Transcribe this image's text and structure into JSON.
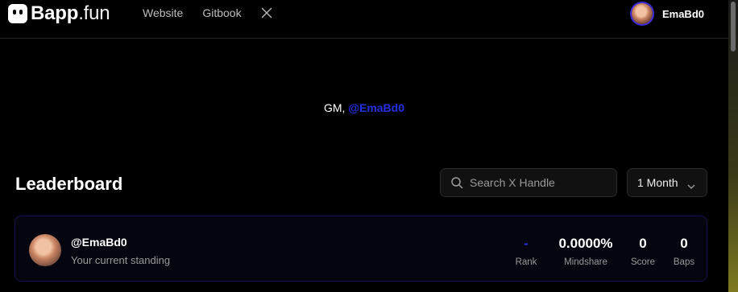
{
  "brand": {
    "name_bold": "Bapp",
    "name_light": ".fun"
  },
  "nav": {
    "website": "Website",
    "gitbook": "Gitbook"
  },
  "user": {
    "name": "EmaBd0"
  },
  "greeting": {
    "prefix": "GM, ",
    "handle": "@EmaBd0"
  },
  "leaderboard": {
    "title": "Leaderboard",
    "search_placeholder": "Search X Handle",
    "period": "1 Month"
  },
  "standing": {
    "handle": "@EmaBd0",
    "subtitle": "Your current standing",
    "stats": [
      {
        "value": "-",
        "label": "Rank"
      },
      {
        "value": "0.0000%",
        "label": "Mindshare"
      },
      {
        "value": "0",
        "label": "Score"
      },
      {
        "value": "0",
        "label": "Baps"
      }
    ]
  },
  "colors": {
    "accent": "#2430e0",
    "background": "#000000"
  }
}
